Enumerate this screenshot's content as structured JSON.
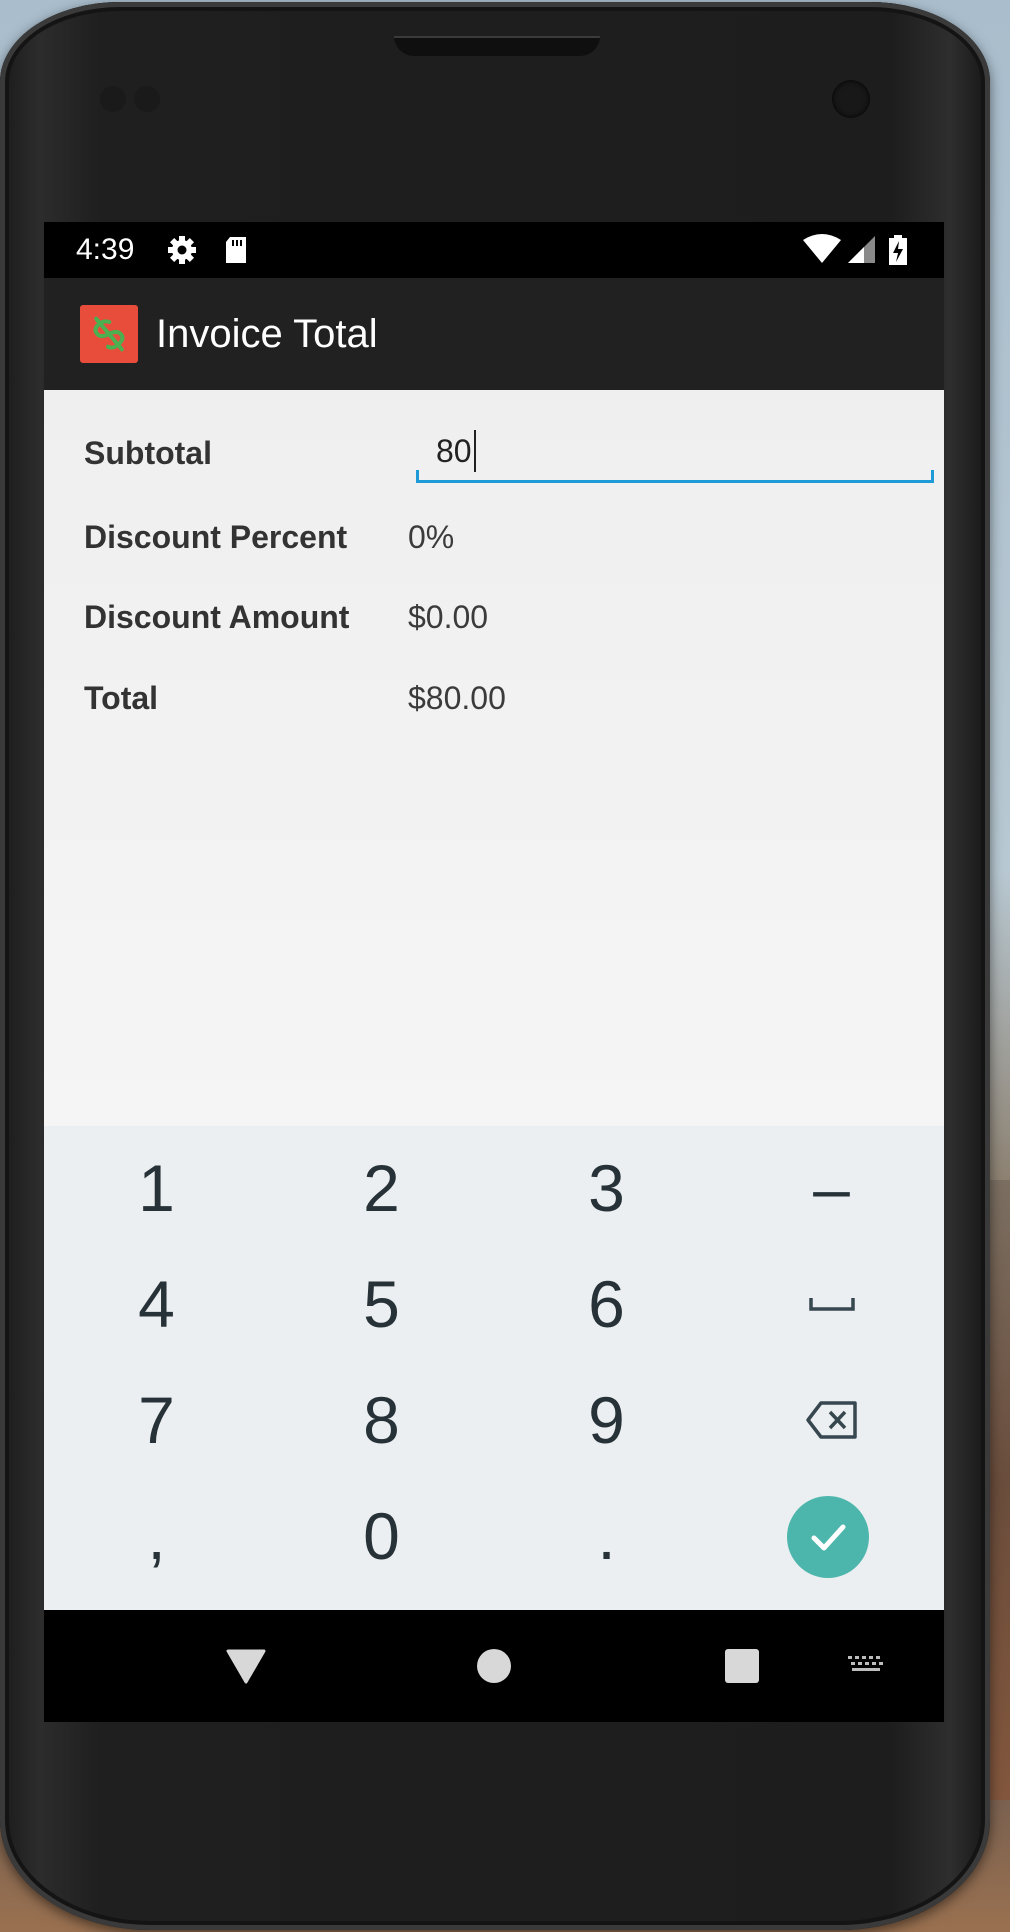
{
  "status_bar": {
    "time": "4:39",
    "icons": [
      "settings-icon",
      "sd-card-icon",
      "wifi-icon",
      "signal-icon",
      "battery-charging-icon"
    ]
  },
  "app_bar": {
    "title": "Invoice Total",
    "logo_icon": "dollar-icon",
    "logo_color": "#e84d3b"
  },
  "form": {
    "subtotal_label": "Subtotal",
    "subtotal_value": "80",
    "discount_percent_label": "Discount Percent",
    "discount_percent_value": "0%",
    "discount_amount_label": "Discount Amount",
    "discount_amount_value": "$0.00",
    "total_label": "Total",
    "total_value": "$80.00",
    "accent_color": "#1e9bd7"
  },
  "keyboard": {
    "keys": [
      [
        "1",
        "2",
        "3",
        "–"
      ],
      [
        "4",
        "5",
        "6",
        "space-icon"
      ],
      [
        "7",
        "8",
        "9",
        "backspace-icon"
      ],
      [
        ",",
        "0",
        ".",
        "done-icon"
      ]
    ],
    "done_color": "#4db6ac"
  },
  "nav_bar": {
    "buttons": [
      "back-icon",
      "home-icon",
      "recents-icon",
      "keyboard-switch-icon"
    ]
  }
}
